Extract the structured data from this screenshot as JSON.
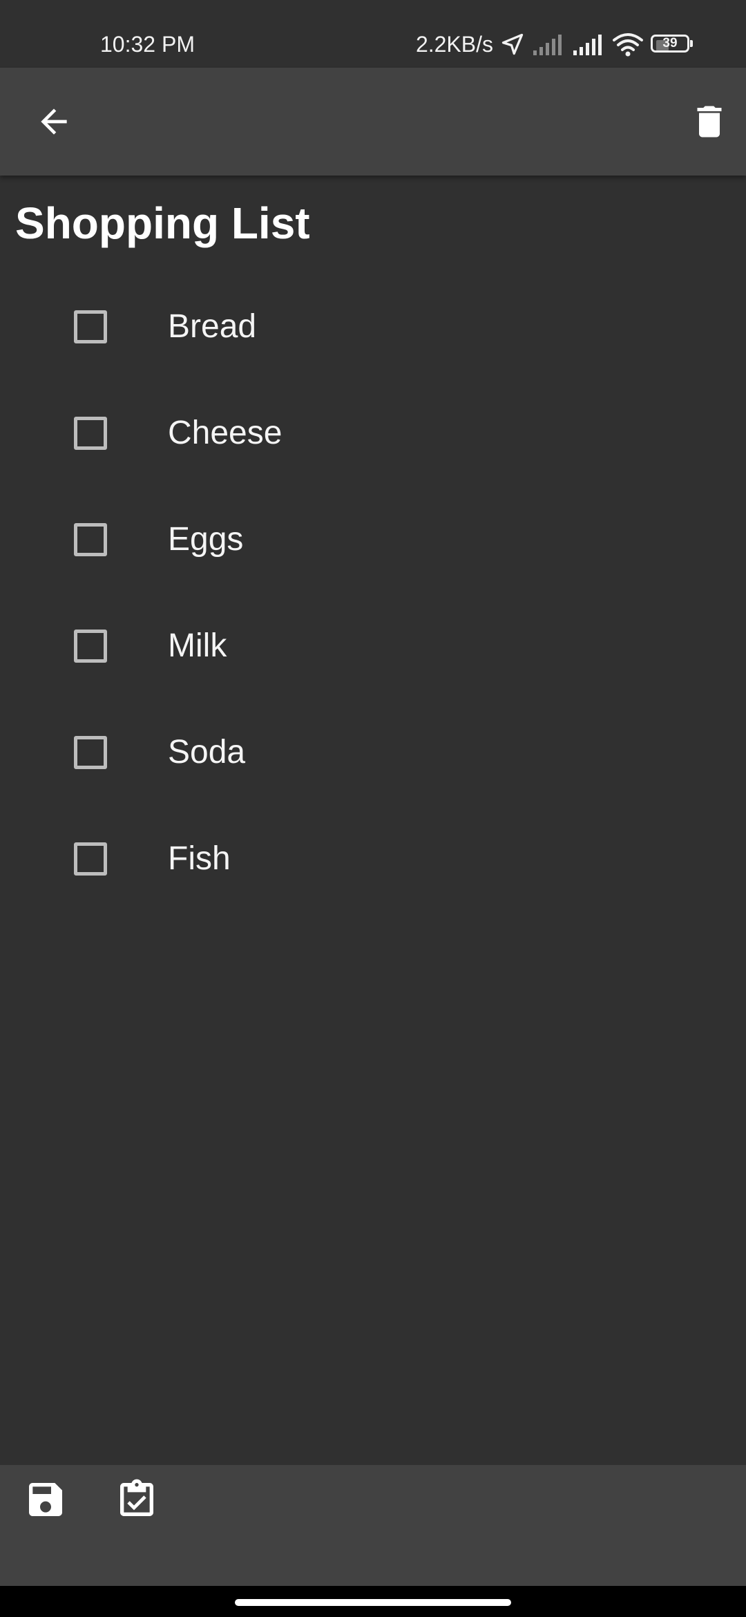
{
  "status_bar": {
    "time": "10:32 PM",
    "network_speed": "2.2KB/s",
    "battery_level": "39",
    "icons": [
      "location-arrow-icon",
      "signal-weak-icon",
      "signal-full-icon",
      "wifi-icon",
      "battery-icon"
    ]
  },
  "app_bar": {
    "back_icon": "arrow-back-icon",
    "delete_icon": "trash-icon"
  },
  "page": {
    "title": "Shopping List"
  },
  "list": {
    "items": [
      {
        "label": "Bread",
        "checked": false
      },
      {
        "label": "Cheese",
        "checked": false
      },
      {
        "label": "Eggs",
        "checked": false
      },
      {
        "label": "Milk",
        "checked": false
      },
      {
        "label": "Soda",
        "checked": false
      },
      {
        "label": "Fish",
        "checked": false
      }
    ]
  },
  "bottom_bar": {
    "save_icon": "save-icon",
    "check_icon": "clipboard-check-icon"
  },
  "colors": {
    "background": "#303030",
    "app_bar": "#424242",
    "text": "#ffffff",
    "checkbox_border": "#bdbdbd"
  }
}
